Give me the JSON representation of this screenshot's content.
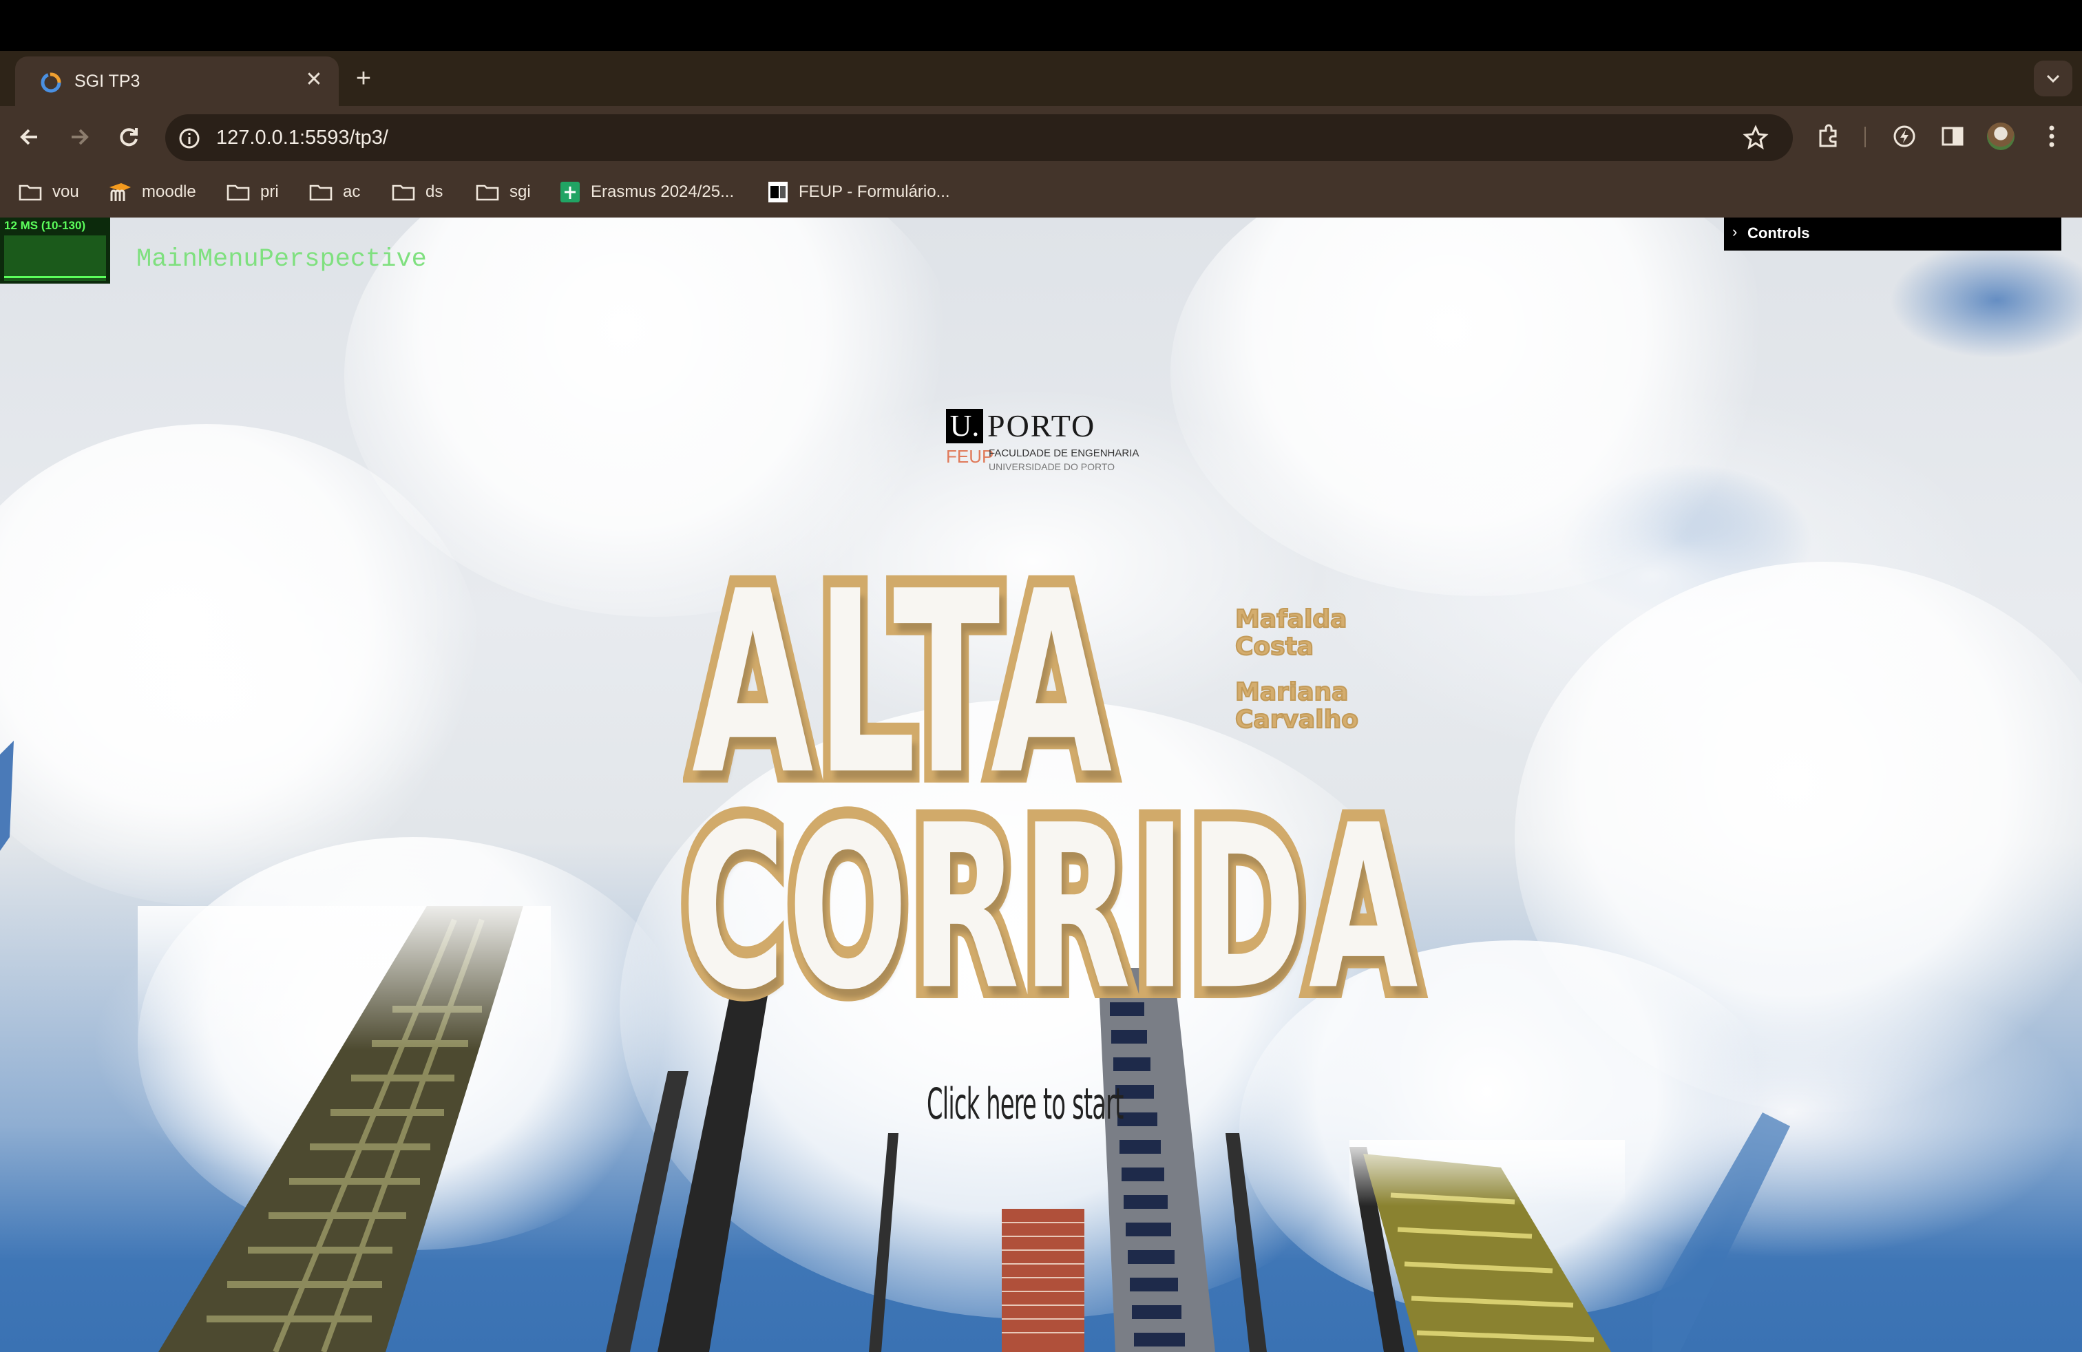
{
  "browser": {
    "tab_title": "SGI TP3",
    "url": "127.0.0.1:5593/tp3/",
    "bookmarks": [
      {
        "label": "vou",
        "icon": "folder-icon"
      },
      {
        "label": "moodle",
        "icon": "moodle-icon"
      },
      {
        "label": "pri",
        "icon": "folder-icon"
      },
      {
        "label": "ac",
        "icon": "folder-icon"
      },
      {
        "label": "ds",
        "icon": "folder-icon"
      },
      {
        "label": "sgi",
        "icon": "folder-icon"
      },
      {
        "label": "Erasmus 2024/25...",
        "icon": "sheets-icon"
      },
      {
        "label": "FEUP - Formulário...",
        "icon": "uporto-icon"
      }
    ]
  },
  "overlay": {
    "stats": "12 MS (10-130)",
    "perspective": "MainMenuPerspective",
    "controls_label": "Controls"
  },
  "menu": {
    "logo": {
      "brand": "U.",
      "name": "PORTO",
      "feup": "FEUP",
      "faculty": "FACULDADE DE ENGENHARIA",
      "university": "UNIVERSIDADE DO PORTO"
    },
    "title_line1": "ALTA",
    "title_line2": "CORRIDA",
    "authors": [
      "Mafalda",
      "Costa",
      "Mariana",
      "Carvalho"
    ],
    "start_label": "Click here to start"
  },
  "colors": {
    "title_outline": "#d1aa6a",
    "title_fill": "#f8f6f2",
    "sky": "#3a72b3",
    "chrome": "#43342a"
  }
}
